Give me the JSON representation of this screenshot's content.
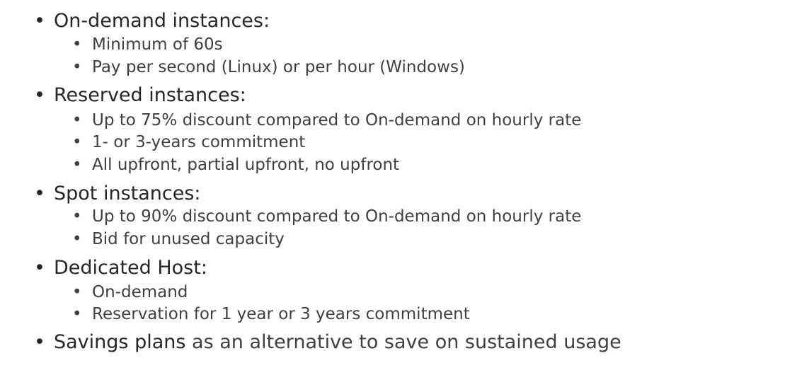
{
  "bullet_glyph": "•",
  "sections": [
    {
      "heading": "On-demand instances:",
      "items": [
        "Minimum of 60s",
        "Pay per second (Linux) or per hour (Windows)"
      ]
    },
    {
      "heading": "Reserved instances:",
      "items": [
        "Up to 75% discount compared to On-demand on hourly rate",
        "1- or 3-years commitment",
        "All upfront, partial upfront, no upfront"
      ]
    },
    {
      "heading": "Spot instances:",
      "items": [
        "Up to 90% discount compared to On-demand on hourly rate",
        "Bid for unused capacity"
      ]
    },
    {
      "heading": "Dedicated Host:",
      "items": [
        "On-demand",
        "Reservation for 1 year or 3 years commitment"
      ]
    }
  ],
  "savings": {
    "term": "Savings plans",
    "rest": " as an alternative to save on sustained usage"
  }
}
